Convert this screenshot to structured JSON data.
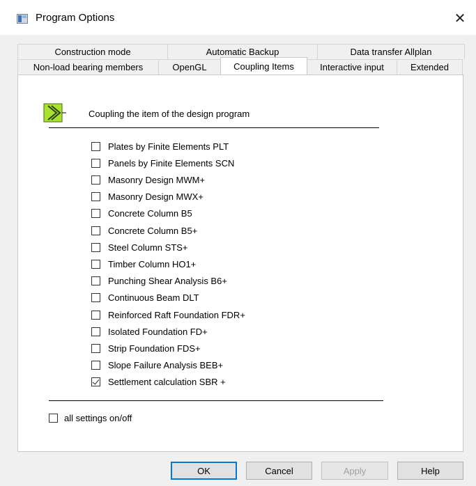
{
  "window": {
    "title": "Program Options",
    "close_symbol": "✕"
  },
  "tabs": {
    "back_row": [
      {
        "label": "Construction mode"
      },
      {
        "label": "Automatic Backup"
      },
      {
        "label": "Data transfer Allplan"
      }
    ],
    "front_row": [
      {
        "label": "Non-load bearing members"
      },
      {
        "label": "OpenGL"
      },
      {
        "label": "Coupling Items",
        "active": true
      },
      {
        "label": "Interactive input"
      },
      {
        "label": "Extended"
      }
    ]
  },
  "panel": {
    "icon": "coupling-arrow-icon",
    "header": "Coupling the item of the design program",
    "items": [
      {
        "label": "Plates by Finite Elements PLT",
        "checked": false
      },
      {
        "label": "Panels by Finite Elements SCN",
        "checked": false
      },
      {
        "label": "Masonry Design MWM+",
        "checked": false
      },
      {
        "label": "Masonry Design MWX+",
        "checked": false
      },
      {
        "label": "Concrete Column B5",
        "checked": false
      },
      {
        "label": "Concrete Column B5+",
        "checked": false
      },
      {
        "label": "Steel Column STS+",
        "checked": false
      },
      {
        "label": "Timber Column HO1+",
        "checked": false
      },
      {
        "label": "Punching Shear Analysis B6+",
        "checked": false
      },
      {
        "label": "Continuous Beam DLT",
        "checked": false
      },
      {
        "label": "Reinforced Raft Foundation FDR+",
        "checked": false
      },
      {
        "label": "Isolated Foundation FD+",
        "checked": false
      },
      {
        "label": "Strip Foundation FDS+",
        "checked": false
      },
      {
        "label": "Slope Failure Analysis BEB+",
        "checked": false
      },
      {
        "label": "Settlement calculation SBR +",
        "checked": true
      }
    ],
    "all_settings_label": "all settings on/off",
    "all_settings_checked": false
  },
  "buttons": {
    "ok": "OK",
    "cancel": "Cancel",
    "apply": "Apply",
    "help": "Help"
  },
  "colors": {
    "icon_fill": "#a6e22e",
    "default_button_border": "#0078d7"
  }
}
